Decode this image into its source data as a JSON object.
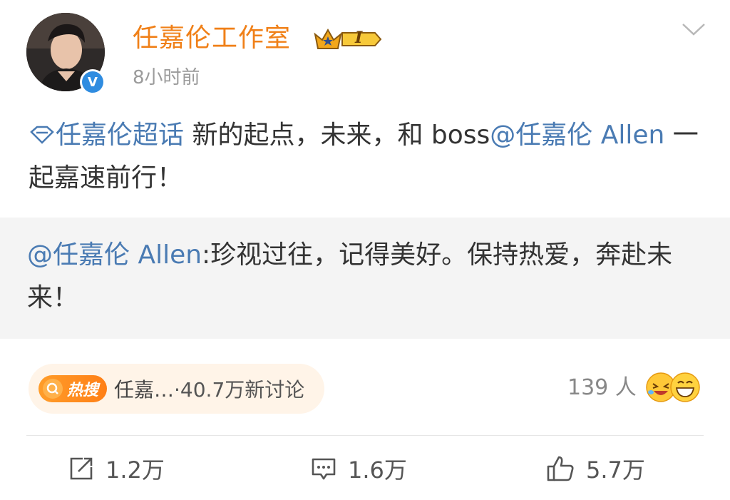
{
  "header": {
    "author_name": "任嘉伦工作室",
    "vip_badge_label": "I",
    "post_time": "8小时前",
    "verified_label": "V"
  },
  "post": {
    "topic_link": "任嘉伦超话",
    "text_1": " 新的起点，未来，和 boss",
    "mention": "@任嘉伦 Allen",
    "text_2": " 一起嘉速前行！"
  },
  "repost": {
    "mention": "@任嘉伦 Allen",
    "text": ":珍视过往，记得美好。保持热爱，奔赴未来！"
  },
  "hot_search": {
    "badge_label": "热搜",
    "topic": "任嘉…",
    "count": "·40.7万新讨论"
  },
  "reactions": {
    "count_label": "139 人"
  },
  "actions": {
    "repost_count": "1.2万",
    "comment_count": "1.6万",
    "like_count": "5.7万"
  },
  "colors": {
    "author_name": "#f08018",
    "link": "#4a7bb3",
    "hot_badge": "#ff8a1f",
    "repost_bg": "#f4f4f4"
  }
}
